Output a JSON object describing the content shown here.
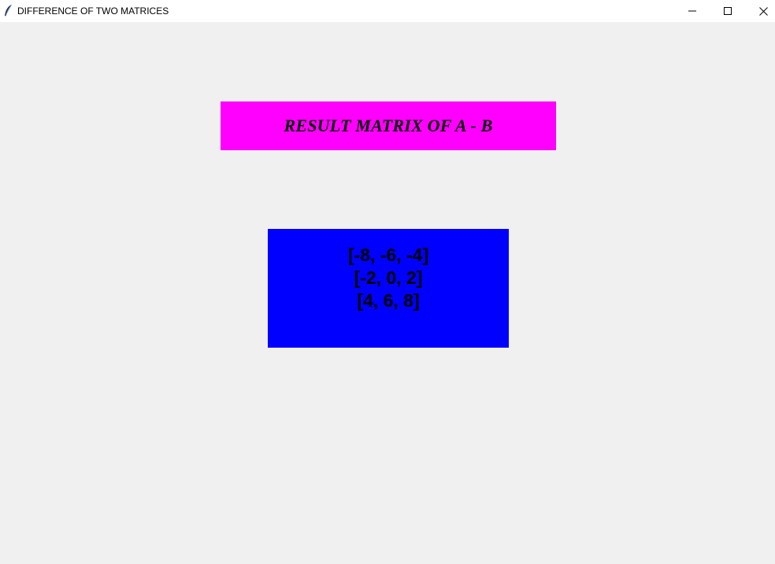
{
  "window": {
    "title": "DIFFERENCE OF TWO MATRICES",
    "icon": "feather-icon",
    "controls": {
      "minimize": "minimize-icon",
      "maximize": "maximize-icon",
      "close": "close-icon"
    }
  },
  "heading": {
    "text": "RESULT MATRIX OF A - B",
    "background": "#ff00ff"
  },
  "result": {
    "background": "#0000ff",
    "rows": [
      "[-8, -6, -4]",
      "[-2, 0, 2]",
      "[4, 6, 8]"
    ]
  }
}
